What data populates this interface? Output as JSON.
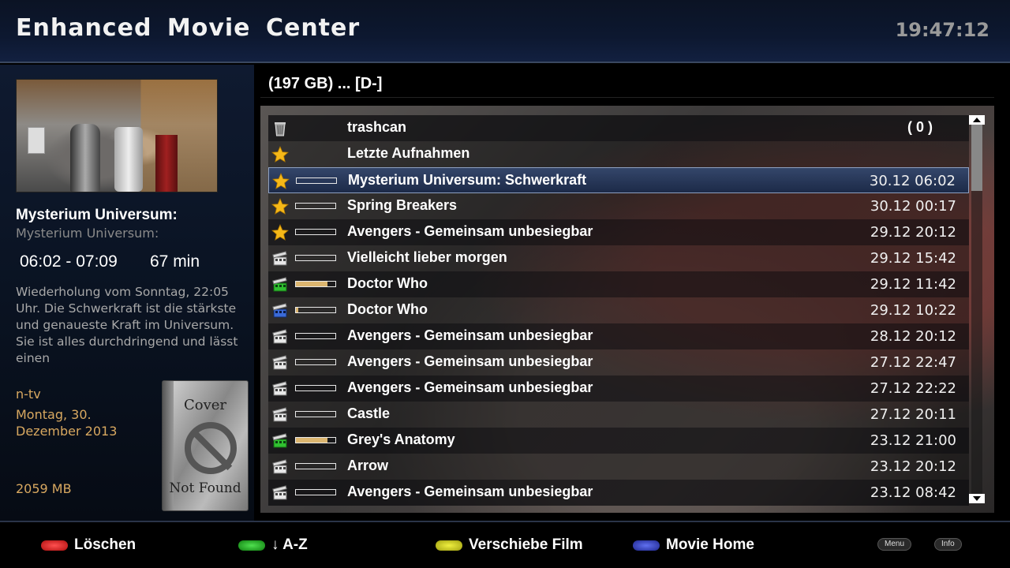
{
  "header": {
    "title": "Enhanced  Movie  Center",
    "clock": "19:47:12"
  },
  "info": {
    "title": "Mysterium Universum:",
    "subtitle": "Mysterium Universum:",
    "time_range": "06:02 - 07:09",
    "duration": "67 min",
    "description": "Wiederholung vom Sonntag, 22:05 Uhr. Die Schwerkraft ist die stärkste und genaueste Kraft im Universum. Sie ist alles durchdringend und lässt einen",
    "channel": "n-tv",
    "date": "Montag, 30. Dezember 2013",
    "size": "2059 MB",
    "cover": {
      "top_text": "Cover",
      "bottom_text": "Not Found",
      "spine_text": "Cover Not Found"
    }
  },
  "path": "(197 GB) ... [D-]",
  "list": {
    "rows": [
      {
        "icon": "trashcan-icon",
        "title": "trashcan",
        "count": "( 0 )",
        "date": "",
        "progress": null
      },
      {
        "icon": "star-icon",
        "title": "Letzte Aufnahmen",
        "date": "",
        "progress": null
      },
      {
        "icon": "star-icon",
        "title": "Mysterium Universum: Schwerkraft",
        "date": "30.12 06:02",
        "progress": 0,
        "selected": true
      },
      {
        "icon": "star-icon",
        "title": "Spring Breakers",
        "date": "30.12 00:17",
        "progress": 0
      },
      {
        "icon": "star-icon",
        "title": "Avengers - Gemeinsam unbesiegbar",
        "date": "29.12 20:12",
        "progress": 0
      },
      {
        "icon": "film-icon",
        "title": "Vielleicht lieber morgen",
        "date": "29.12 15:42",
        "progress": 0
      },
      {
        "icon": "film-icon-green",
        "title": "Doctor Who",
        "date": "29.12 11:42",
        "progress": 0.8
      },
      {
        "icon": "film-icon-blue",
        "title": "Doctor Who",
        "date": "29.12 10:22",
        "progress": 0.05
      },
      {
        "icon": "film-icon",
        "title": "Avengers - Gemeinsam unbesiegbar",
        "date": "28.12 20:12",
        "progress": 0
      },
      {
        "icon": "film-icon",
        "title": "Avengers - Gemeinsam unbesiegbar",
        "date": "27.12 22:47",
        "progress": 0
      },
      {
        "icon": "film-icon",
        "title": "Avengers - Gemeinsam unbesiegbar",
        "date": "27.12 22:22",
        "progress": 0
      },
      {
        "icon": "film-icon",
        "title": "Castle",
        "date": "27.12 20:11",
        "progress": 0
      },
      {
        "icon": "film-icon-green",
        "title": "Grey's Anatomy",
        "date": "23.12 21:00",
        "progress": 0.8
      },
      {
        "icon": "film-icon",
        "title": "Arrow",
        "date": "23.12 20:12",
        "progress": 0
      },
      {
        "icon": "film-icon",
        "title": "Avengers - Gemeinsam unbesiegbar",
        "date": "23.12 08:42",
        "progress": 0
      }
    ],
    "scroll_position": 0.0
  },
  "footer": {
    "red_label": "Löschen",
    "green_label": "↓ A-Z",
    "yellow_label": "Verschiebe Film",
    "blue_label": "Movie Home",
    "menu_label": "Menu",
    "info_label": "Info"
  },
  "colors": {
    "red": "#d02020",
    "green": "#20b020",
    "yellow": "#d8d820",
    "blue": "#3040c0",
    "accent": "#d8a860",
    "progress_fill": "#dcb670"
  }
}
